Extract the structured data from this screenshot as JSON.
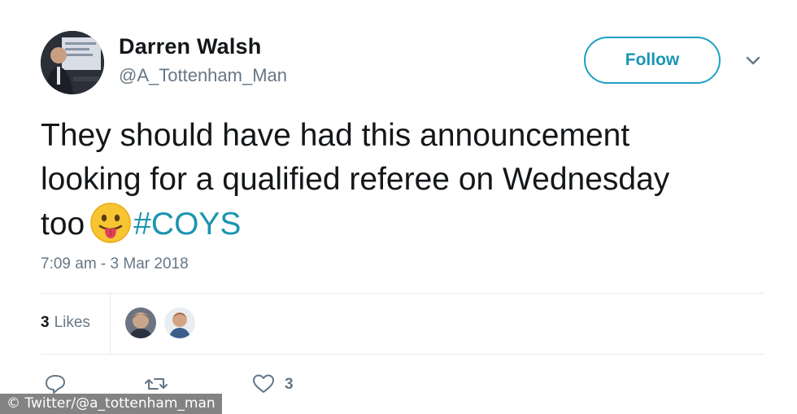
{
  "author": {
    "display_name": "Darren Walsh",
    "handle": "@A_Tottenham_Man",
    "avatar_icon": "profile-photo"
  },
  "follow_button": {
    "label": "Follow",
    "accent_color": "#1da1c2"
  },
  "menu": {
    "caret_icon": "chevron-down-icon"
  },
  "tweet": {
    "line1": "They should have had this announcement",
    "line2": "looking for a qualified referee on Wednesday",
    "line3_text": "too",
    "emoji": "face-with-tongue-emoji",
    "hashtag": "#COYS",
    "hashtag_color": "#1b95b0"
  },
  "timestamp": "7:09 am - 3 Mar 2018",
  "stats": {
    "likes_count": "3",
    "likes_label": "Likes"
  },
  "actions": {
    "reply_icon": "reply-icon",
    "retweet_icon": "retweet-icon",
    "like_icon": "heart-icon",
    "like_count": "3"
  },
  "watermark": "© Twitter/@a_tottenham_man"
}
